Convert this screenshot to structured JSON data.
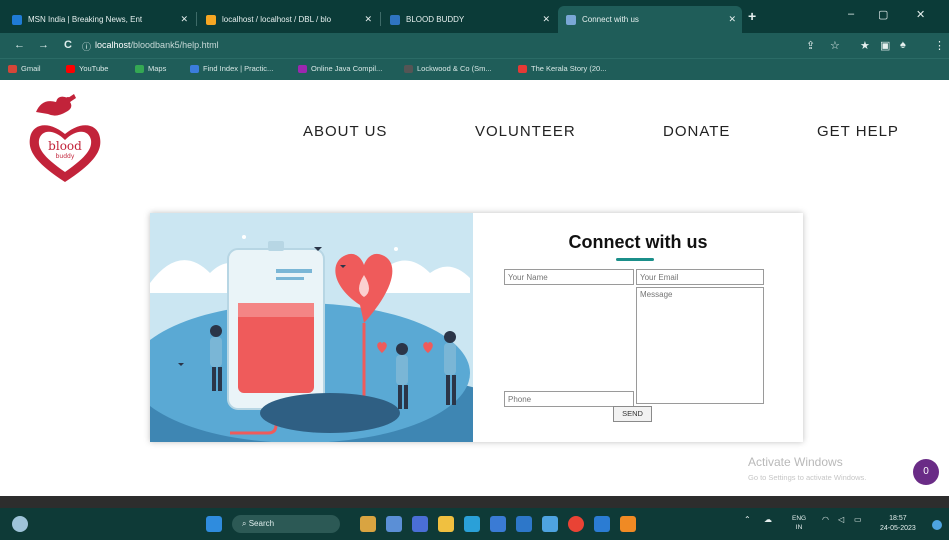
{
  "browser": {
    "tabs": [
      {
        "label": "MSN India | Breaking News, Ent",
        "color": "#1f7bd6"
      },
      {
        "label": "localhost / localhost / DBL / blo",
        "color": "#f5a623"
      },
      {
        "label": "BLOOD BUDDY",
        "color": "#2f74c0"
      },
      {
        "label": "Connect with us",
        "color": "#7aa7d6"
      }
    ],
    "new_tab": "+",
    "window_controls": {
      "minimize": "–",
      "maximize": "▢",
      "close": "✕"
    },
    "nav": {
      "back": "←",
      "forward": "→",
      "reload": "C",
      "info": "ⓘ"
    },
    "url_host": "localhost",
    "url_path": "/bloodbank5/help.html",
    "right_icons": [
      "⇪",
      "☆",
      "★",
      "▣",
      "♠",
      "⋮"
    ],
    "bookmarks": [
      {
        "label": "Gmail",
        "color": "#d44638"
      },
      {
        "label": "YouTube",
        "color": "#ff0000"
      },
      {
        "label": "Maps",
        "color": "#34a853"
      },
      {
        "label": "Find Index | Practic...",
        "color": "#3b7ddd"
      },
      {
        "label": "Online Java Compil...",
        "color": "#9c27b0"
      },
      {
        "label": "Lockwood & Co (Sm...",
        "color": "#555555"
      },
      {
        "label": "The Kerala Story (20...",
        "color": "#e53935"
      }
    ]
  },
  "site": {
    "logo_text_1": "blood",
    "logo_text_2": "buddy",
    "nav": [
      "ABOUT US",
      "VOLUNTEER",
      "DONATE",
      "GET HELP"
    ]
  },
  "contact": {
    "title": "Connect with us",
    "name_placeholder": "Your Name",
    "email_placeholder": "Your Email",
    "message_placeholder": "Message",
    "phone_placeholder": "Phone",
    "send_label": "SEND"
  },
  "overlay": {
    "activate_title": "Activate Windows",
    "activate_sub": "Go to Settings to activate Windows.",
    "chat_badge": "0"
  },
  "taskbar": {
    "search": "Search",
    "tray_lang_1": "ENG",
    "tray_lang_2": "IN",
    "time": "18:57",
    "date": "24-05-2023"
  }
}
